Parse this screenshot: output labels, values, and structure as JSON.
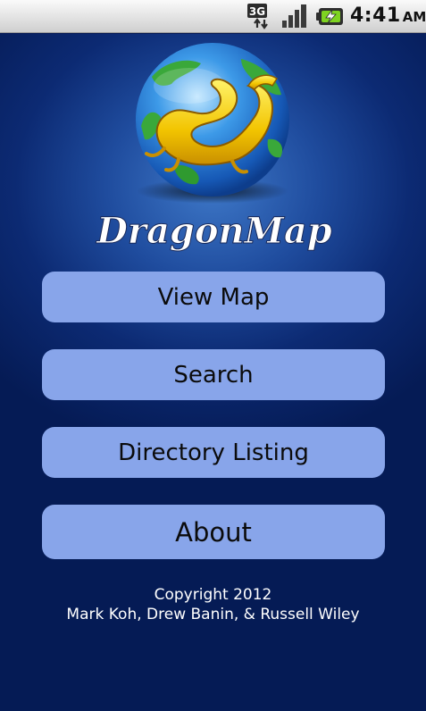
{
  "status_bar": {
    "network": "3G",
    "time": "4:41",
    "ampm": "AM"
  },
  "app": {
    "title": "DragonMap"
  },
  "menu": {
    "view_map": "View Map",
    "search": "Search",
    "directory": "Directory Listing",
    "about": "About"
  },
  "footer": {
    "copyright": "Copyright 2012",
    "authors": "Mark Koh, Drew Banin, & Russell Wiley"
  }
}
